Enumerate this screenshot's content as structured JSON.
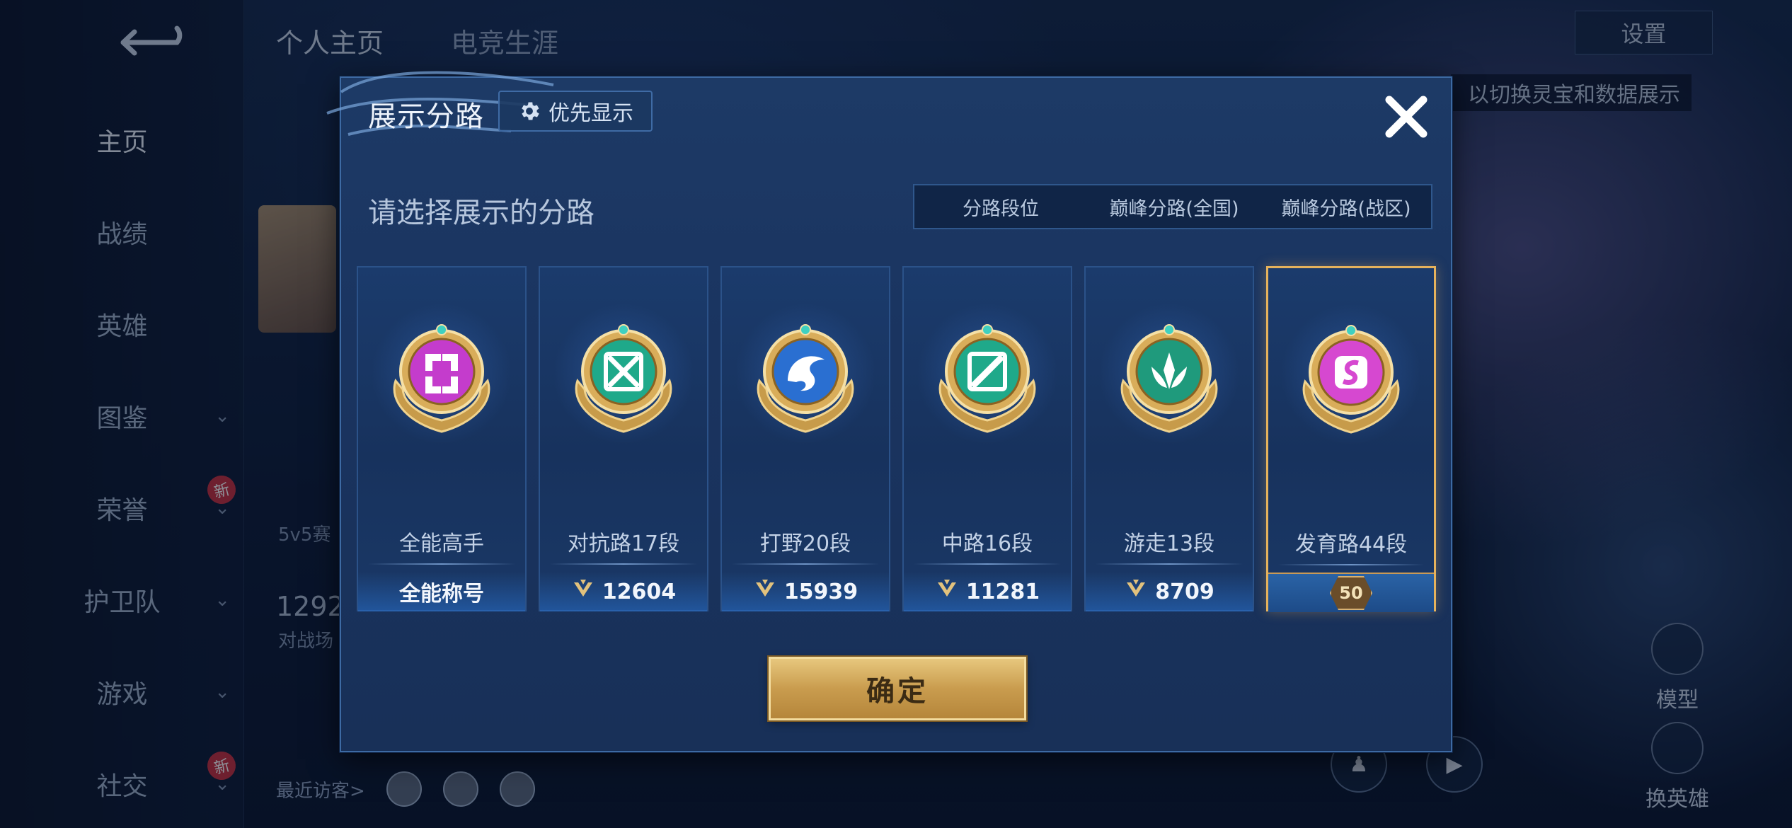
{
  "background": {
    "top_tabs": [
      "个人主页",
      "电竞生涯"
    ],
    "nav": [
      {
        "label": "主页",
        "active": true,
        "chevron": false,
        "new": false
      },
      {
        "label": "战绩",
        "active": false,
        "chevron": false,
        "new": false
      },
      {
        "label": "英雄",
        "active": false,
        "chevron": false,
        "new": false
      },
      {
        "label": "图鉴",
        "active": false,
        "chevron": true,
        "new": false
      },
      {
        "label": "荣誉",
        "active": false,
        "chevron": true,
        "new": true
      },
      {
        "label": "护卫队",
        "active": false,
        "chevron": true,
        "new": false
      },
      {
        "label": "游戏",
        "active": false,
        "chevron": true,
        "new": false
      },
      {
        "label": "社交",
        "active": false,
        "chevron": true,
        "new": true
      }
    ],
    "new_badge": "新",
    "settings_label": "设置",
    "hint": "以切换灵宝和数据展示",
    "mode_label": "5v5赛",
    "stat_value": "1292",
    "stat_label": "对战场",
    "recent_visitors": "最近访客>",
    "model_label": "模型",
    "switch_hero_label": "换英雄"
  },
  "modal": {
    "title": "展示分路",
    "priority_button": "优先显示",
    "prompt": "请选择展示的分路",
    "segments": [
      "分路段位",
      "巅峰分路(全国)",
      "巅峰分路(战区)"
    ],
    "active_segment": 0,
    "cards": [
      {
        "name": "全能高手",
        "score": "全能称号",
        "has_icon": false,
        "emblem": "allround-emblem",
        "color": "#c43ccc",
        "selected": false
      },
      {
        "name": "对抗路17段",
        "score": "12604",
        "has_icon": true,
        "emblem": "clash-lane-emblem",
        "color": "#1fa98a",
        "selected": false
      },
      {
        "name": "打野20段",
        "score": "15939",
        "has_icon": true,
        "emblem": "jungle-emblem",
        "color": "#2a6fd1",
        "selected": false
      },
      {
        "name": "中路16段",
        "score": "11281",
        "has_icon": true,
        "emblem": "mid-lane-emblem",
        "color": "#1fa98a",
        "selected": false
      },
      {
        "name": "游走13段",
        "score": "8709",
        "has_icon": true,
        "emblem": "roam-emblem",
        "color": "#1f9a7c",
        "selected": false
      },
      {
        "name": "发育路44段",
        "score": "50",
        "has_icon": false,
        "emblem": "farm-lane-emblem",
        "color": "#d648d0",
        "selected": true
      }
    ],
    "confirm": "确定"
  }
}
